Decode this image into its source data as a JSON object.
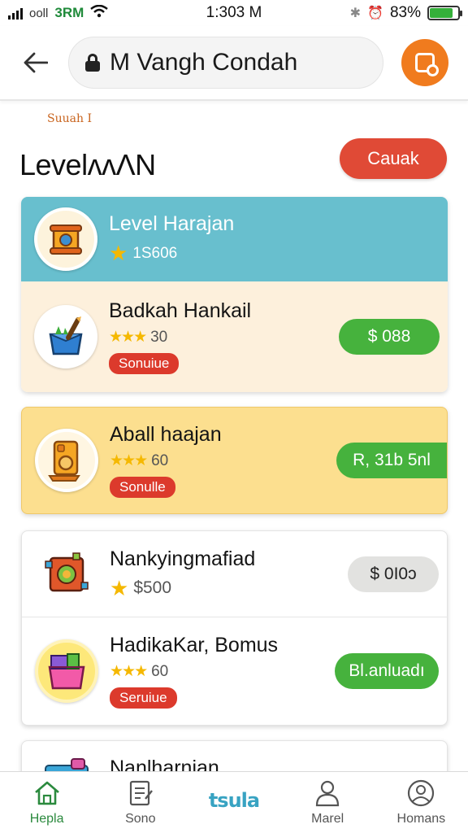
{
  "status_bar": {
    "carrier": "3RM",
    "carrier_prefix": "ooll",
    "time": "1:303 M",
    "battery": "83%",
    "battery_level": 0.83
  },
  "header": {
    "search_text": "M Vangh Condah"
  },
  "section": {
    "kicker": "Suuah  I",
    "title": "LevelʌʌɅN",
    "action_label": "Cauak"
  },
  "items": [
    {
      "name": "Level Harajan",
      "rating_text": "1S606",
      "stars": "★"
    },
    {
      "name": "Badkah Hankail",
      "rating_text": "30",
      "stars": "★★★",
      "tag": "Sonuiue",
      "price": "$ 088"
    },
    {
      "name": "Aball haajan",
      "rating_text": "60",
      "stars": "★★★",
      "tag": "Sonulle",
      "price": "R, 31b 5nl"
    },
    {
      "name": "Nankyingmafiad",
      "rating_text": "$500",
      "stars": "★",
      "price": "$ 0I0ɔ"
    },
    {
      "name": "HadikaKar, Bomus",
      "rating_text": "60",
      "stars": "★★★",
      "tag": "Seruiue",
      "price": "Bl.anluadı"
    },
    {
      "name": "Nanlharnian"
    }
  ],
  "bottom_nav": [
    {
      "label": "Hepla",
      "icon": "home-icon"
    },
    {
      "label": "Sono",
      "icon": "notes-icon"
    },
    {
      "label": "tsula",
      "icon": "brand-logo"
    },
    {
      "label": "Marel",
      "icon": "person-icon"
    },
    {
      "label": "Homans",
      "icon": "profile-icon"
    }
  ],
  "colors": {
    "accent_orange": "#f07b1e",
    "red": "#e04a36",
    "green": "#46b23d",
    "teal": "#68bfce",
    "gold": "#fcdf8f"
  }
}
